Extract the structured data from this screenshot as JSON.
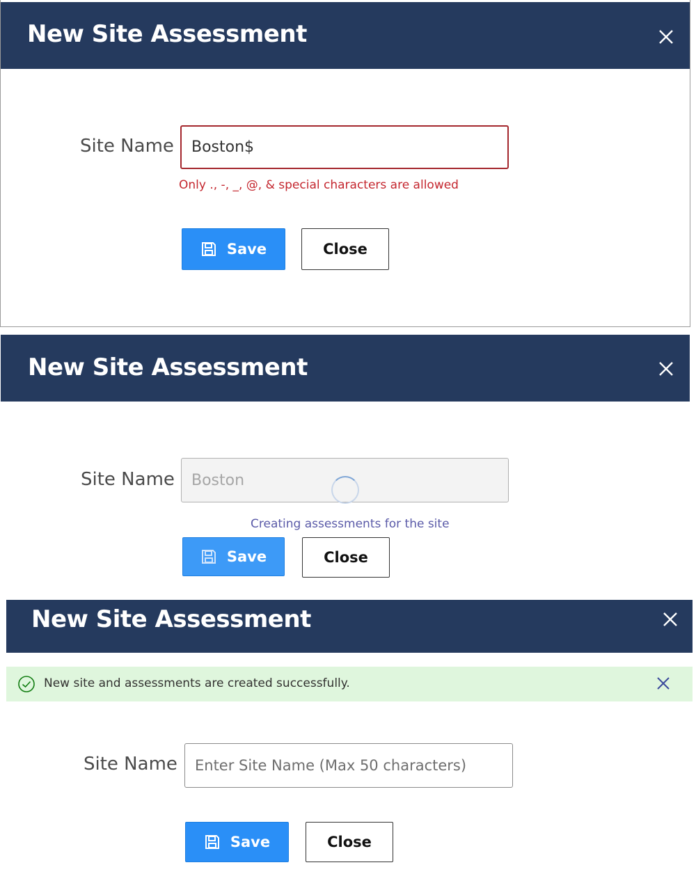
{
  "dialogs": [
    {
      "title": "New Site Assessment",
      "site_name_label": "Site Name",
      "site_name_value": "Boston$",
      "validation_error": "Only ., -, _, @, & special characters are allowed",
      "save_label": "Save",
      "close_label": "Close",
      "state": "invalid"
    },
    {
      "title": "New Site Assessment",
      "site_name_label": "Site Name",
      "site_name_value": "Boston",
      "progress_message": "Creating assessments for the site",
      "save_label": "Save",
      "close_label": "Close",
      "state": "creating"
    },
    {
      "title": "New Site Assessment",
      "success_message": "New site and assessments are created successfully.",
      "site_name_label": "Site Name",
      "site_name_placeholder": "Enter Site Name (Max 50 characters)",
      "save_label": "Save",
      "close_label": "Close",
      "state": "success"
    }
  ],
  "colors": {
    "header_bg": "#253a5e",
    "primary_button": "#2a8ff7",
    "error": "#c4262e",
    "success_bg": "#dff6dd",
    "success_icon": "#107c10"
  },
  "icons": {
    "dialog_close": "close-icon",
    "save": "floppy-disk-icon",
    "success": "check-circle-icon",
    "dismiss": "close-icon"
  }
}
